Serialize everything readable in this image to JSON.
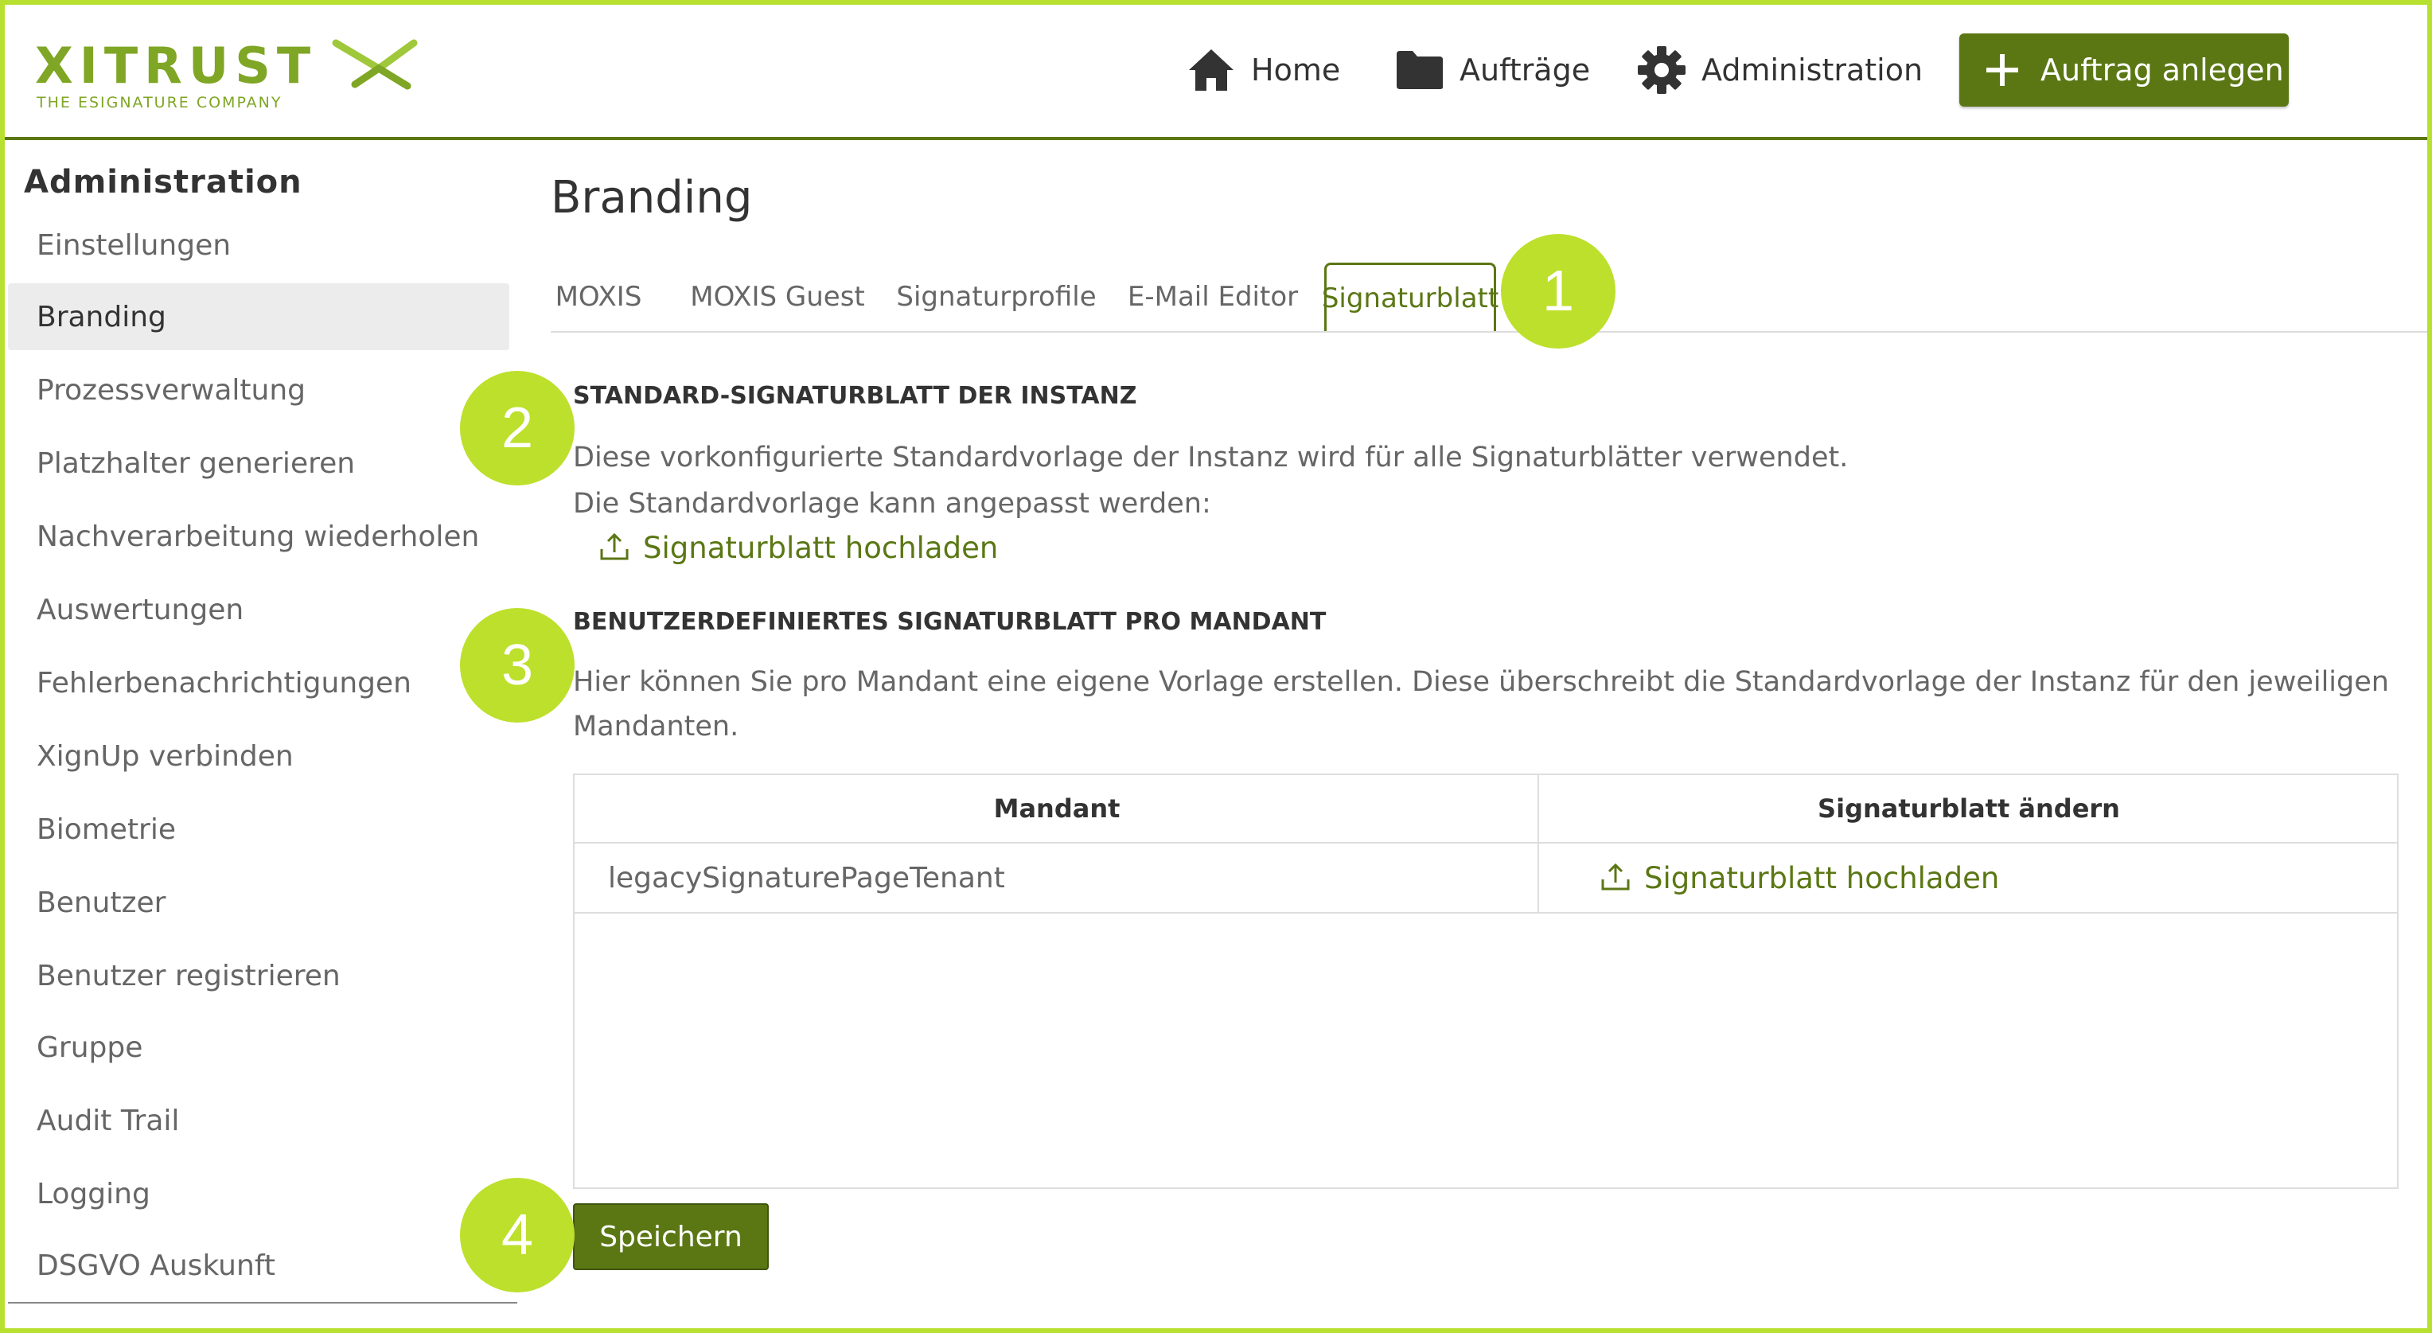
{
  "brand": {
    "name": "XITRUST",
    "tagline": "THE ESIGNATURE COMPANY",
    "accent": "#5b7714",
    "highlight": "#bde02c"
  },
  "nav": {
    "home": "Home",
    "auftraege": "Aufträge",
    "administration": "Administration",
    "create_order": "Auftrag anlegen"
  },
  "sidebar": {
    "title": "Administration",
    "items": [
      {
        "label": "Einstellungen",
        "active": false
      },
      {
        "label": "Branding",
        "active": true
      },
      {
        "label": "Prozessverwaltung",
        "active": false
      },
      {
        "label": "Platzhalter generieren",
        "active": false
      },
      {
        "label": "Nachverarbeitung wiederholen",
        "active": false
      },
      {
        "label": "Auswertungen",
        "active": false
      },
      {
        "label": "Fehlerbenachrichtigungen",
        "active": false
      },
      {
        "label": "XignUp verbinden",
        "active": false
      },
      {
        "label": "Biometrie",
        "active": false
      },
      {
        "label": "Benutzer",
        "active": false
      },
      {
        "label": "Benutzer registrieren",
        "active": false
      },
      {
        "label": "Gruppe",
        "active": false
      },
      {
        "label": "Audit Trail",
        "active": false
      },
      {
        "label": "Logging",
        "active": false
      },
      {
        "label": "DSGVO Auskunft",
        "active": false
      }
    ]
  },
  "main": {
    "title": "Branding",
    "tabs": [
      {
        "label": "MOXIS"
      },
      {
        "label": "MOXIS Guest"
      },
      {
        "label": "Signaturprofile"
      },
      {
        "label": "E-Mail Editor"
      },
      {
        "label": "Signaturblatt"
      }
    ],
    "active_tab": "Signaturblatt",
    "section_default": {
      "title": "STANDARD-SIGNATURBLATT DER INSTANZ",
      "line1": "Diese vorkonfigurierte Standardvorlage der Instanz wird für alle Signaturblätter verwendet.",
      "line2": "Die Standardvorlage kann angepasst werden:",
      "upload": "Signaturblatt hochladen"
    },
    "section_tenant": {
      "title": "BENUTZERDEFINIERTES SIGNATURBLATT PRO MANDANT",
      "line1": "Hier können Sie pro Mandant eine eigene Vorlage erstellen. Diese überschreibt die Standardvorlage der Instanz für den jeweiligen",
      "line2": "Mandanten."
    },
    "table": {
      "columns": [
        "Mandant",
        "Signaturblatt ändern"
      ],
      "rows": [
        {
          "mandant": "legacySignaturePageTenant",
          "action": "Signaturblatt hochladen"
        }
      ]
    },
    "save": "Speichern"
  },
  "badges": [
    "1",
    "2",
    "3",
    "4"
  ],
  "icons": [
    "home-icon",
    "folder-icon",
    "gear-icon",
    "plus-icon",
    "upload-icon"
  ]
}
